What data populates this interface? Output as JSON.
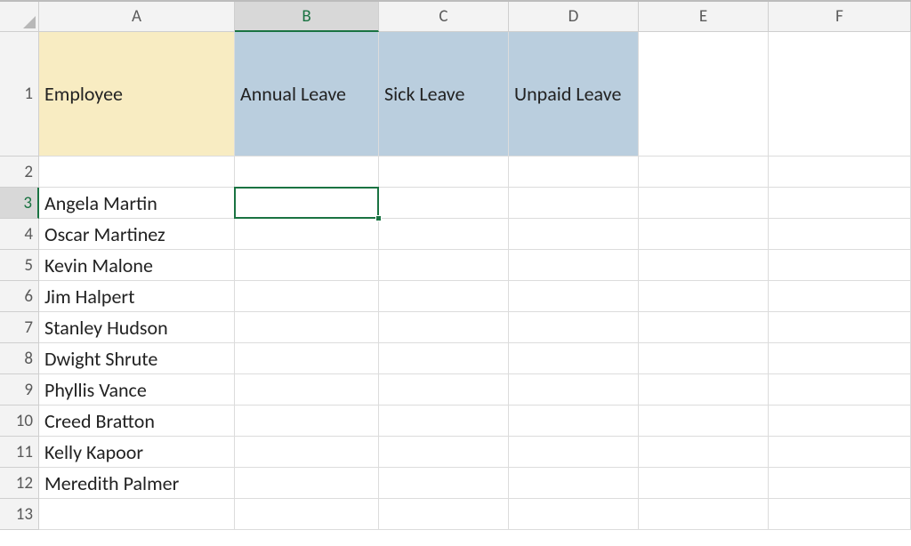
{
  "columns": [
    "A",
    "B",
    "C",
    "D",
    "E",
    "F"
  ],
  "rowNumbers": [
    1,
    2,
    3,
    4,
    5,
    6,
    7,
    8,
    9,
    10,
    11,
    12,
    13
  ],
  "activeColIndex": 1,
  "activeRowNumber": 3,
  "header": {
    "A1": "Employee",
    "B1": "Annual Leave",
    "C1": "Sick Leave",
    "D1": "Unpaid Leave"
  },
  "employees": [
    "Angela Martin",
    "Oscar Martinez",
    "Kevin Malone",
    "Jim Halpert",
    "Stanley Hudson",
    "Dwight Shrute",
    "Phyllis Vance",
    "Creed Bratton",
    "Kelly Kapoor",
    "Meredith Palmer"
  ],
  "colors": {
    "yellowFill": "#f8ecc2",
    "blueFill": "#bacede",
    "selectionBorder": "#1a7342"
  }
}
